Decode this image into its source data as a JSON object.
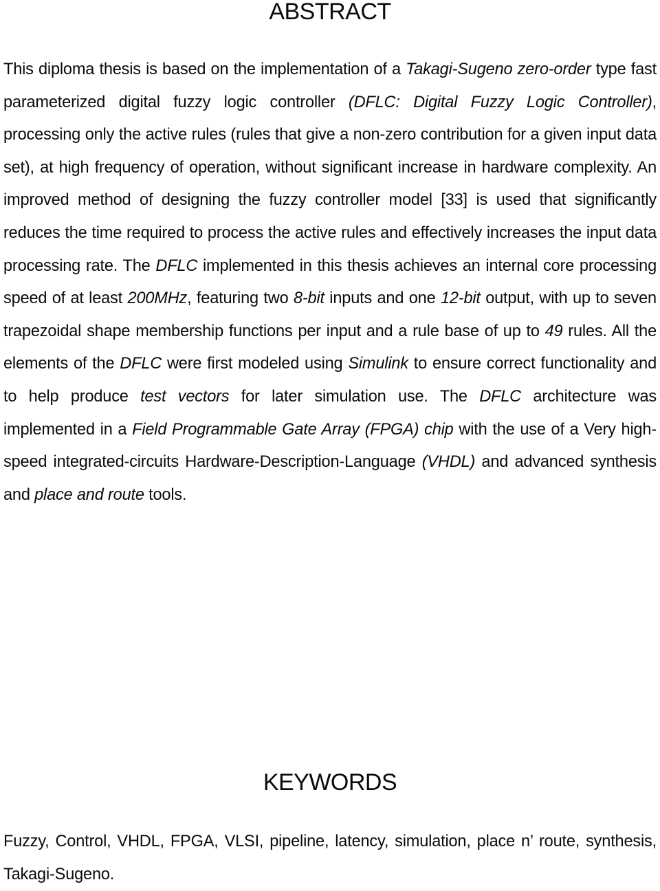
{
  "abstract": {
    "heading": "ABSTRACT",
    "segments": [
      {
        "t": "This diploma thesis is based on the implementation of a ",
        "i": false
      },
      {
        "t": "Takagi-Sugeno zero-order",
        "i": true
      },
      {
        "t": " type fast parameterized digital fuzzy logic controller ",
        "i": false
      },
      {
        "t": "(DFLC: Digital Fuzzy Logic Controller)",
        "i": true
      },
      {
        "t": ", processing only the active rules (rules that give a non-zero contribution for a given input data set), at high frequency of operation, without significant increase in hardware complexity. An improved method of designing the fuzzy controller model [33] is used that significantly reduces the time required to process the active rules and effectively increases the input data processing rate. The ",
        "i": false
      },
      {
        "t": "DFLC",
        "i": true
      },
      {
        "t": " implemented in this thesis achieves an internal core processing speed of at least ",
        "i": false
      },
      {
        "t": "200MHz",
        "i": true
      },
      {
        "t": ", featuring two ",
        "i": false
      },
      {
        "t": "8-bit",
        "i": true
      },
      {
        "t": " inputs and one ",
        "i": false
      },
      {
        "t": "12-bit",
        "i": true
      },
      {
        "t": " output, with up to seven trapezoidal shape membership functions per input and a rule base of up to ",
        "i": false
      },
      {
        "t": "49",
        "i": true
      },
      {
        "t": " rules. All the elements of the ",
        "i": false
      },
      {
        "t": "DFLC",
        "i": true
      },
      {
        "t": " were first modeled using ",
        "i": false
      },
      {
        "t": "Simulink",
        "i": true
      },
      {
        "t": " to ensure correct functionality and to help produce ",
        "i": false
      },
      {
        "t": "test vectors",
        "i": true
      },
      {
        "t": " for later simulation use. The ",
        "i": false
      },
      {
        "t": "DFLC",
        "i": true
      },
      {
        "t": " architecture was implemented in a ",
        "i": false
      },
      {
        "t": "Field Programmable Gate Array (FPGA) chip",
        "i": true
      },
      {
        "t": " with the use of a Very high-speed integrated-circuits Hardware-Description-Language ",
        "i": false
      },
      {
        "t": "(VHDL)",
        "i": true
      },
      {
        "t": " and advanced synthesis and ",
        "i": false
      },
      {
        "t": "place and route",
        "i": true
      },
      {
        "t": " tools.",
        "i": false
      }
    ]
  },
  "keywords": {
    "heading": "KEYWORDS",
    "text": "Fuzzy, Control, VHDL, FPGA, VLSI, pipeline, latency, simulation, place n’ route, synthesis, Takagi-Sugeno."
  }
}
